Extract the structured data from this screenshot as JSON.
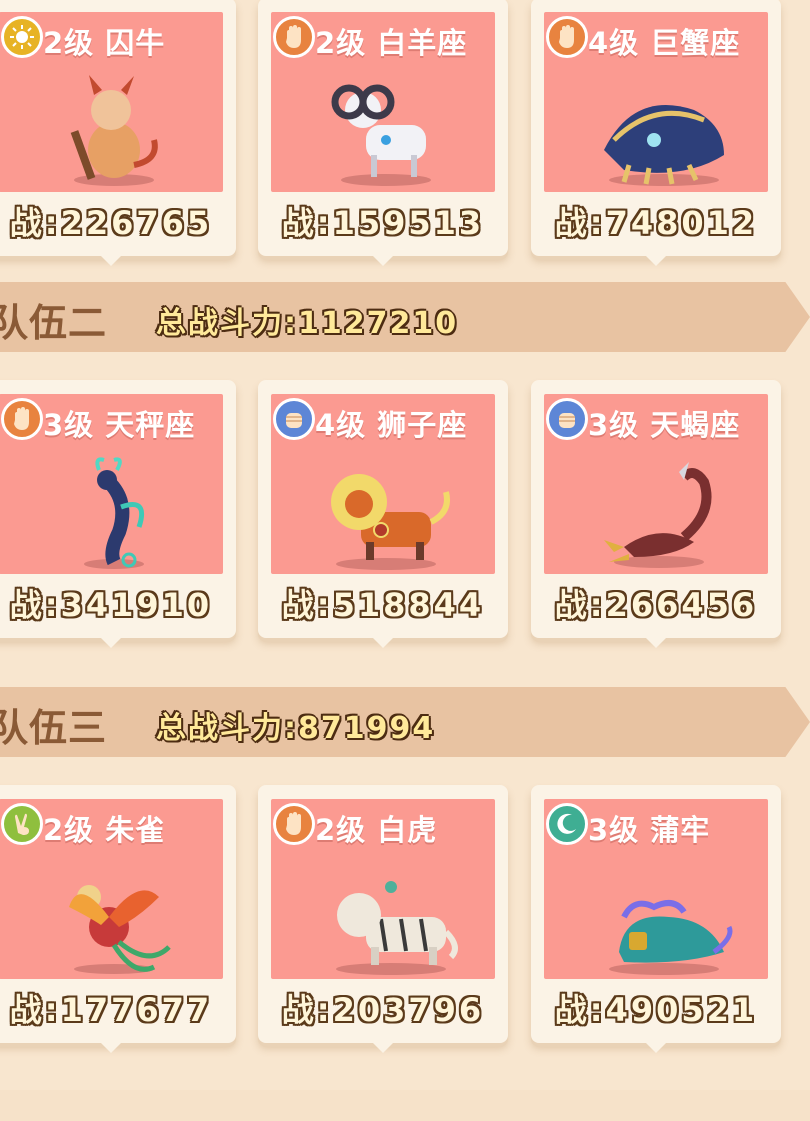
{
  "teams": [
    {
      "name": "",
      "total_label": "",
      "pets": [
        {
          "level_name": "2级 囚牛",
          "power": "战:226765",
          "badge": "sun-icon",
          "badge_color": "#e7b325"
        },
        {
          "level_name": "2级 白羊座",
          "power": "战:159513",
          "badge": "hand-icon",
          "badge_color": "#e8833f"
        },
        {
          "level_name": "4级 巨蟹座",
          "power": "战:748012",
          "badge": "hand-icon",
          "badge_color": "#e8833f"
        }
      ]
    },
    {
      "name": "队伍二",
      "total_label": "总战斗力:1127210",
      "pets": [
        {
          "level_name": "3级 天秤座",
          "power": "战:341910",
          "badge": "hand-icon",
          "badge_color": "#e8833f"
        },
        {
          "level_name": "4级 狮子座",
          "power": "战:518844",
          "badge": "fist-icon",
          "badge_color": "#5d86d6"
        },
        {
          "level_name": "3级 天蝎座",
          "power": "战:266456",
          "badge": "fist-icon",
          "badge_color": "#5d86d6"
        }
      ]
    },
    {
      "name": "队伍三",
      "total_label": "总战斗力:871994",
      "pets": [
        {
          "level_name": "2级 朱雀",
          "power": "战:177677",
          "badge": "scissors-icon",
          "badge_color": "#8fbf3e"
        },
        {
          "level_name": "2级 白虎",
          "power": "战:203796",
          "badge": "hand-icon",
          "badge_color": "#e8833f"
        },
        {
          "level_name": "3级 蒲牢",
          "power": "战:490521",
          "badge": "moon-icon",
          "badge_color": "#3fae93"
        }
      ]
    }
  ]
}
